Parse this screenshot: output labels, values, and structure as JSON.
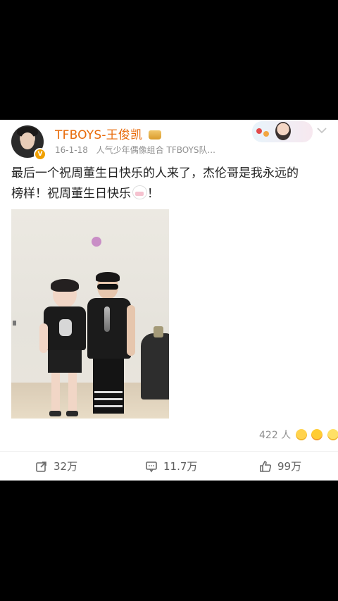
{
  "post": {
    "author": "TFBOYS-王俊凯",
    "time": "16-1-18",
    "source": "人气少年偶像组合 TFBOYS队...",
    "text_line1": "最后一个祝周董生日快乐的人来了，杰伦哥是我永远的",
    "text_line2_before": "榜样！祝周董生日快乐",
    "text_line2_after": "！",
    "reaction_count": "422 人",
    "actions": {
      "share": "32万",
      "comment": "11.7万",
      "like": "99万"
    }
  },
  "colors": {
    "username": "#e86b0b",
    "meta": "#8f8f8f",
    "text": "#222222",
    "background": "#000000",
    "card": "#ffffff"
  },
  "icons": {
    "verified": "verified-badge-icon",
    "crown": "crown-badge-icon",
    "chevron": "chevron-down-icon",
    "cake": "birthday-cake-icon",
    "share": "share-icon",
    "comment": "comment-icon",
    "like": "like-icon"
  }
}
